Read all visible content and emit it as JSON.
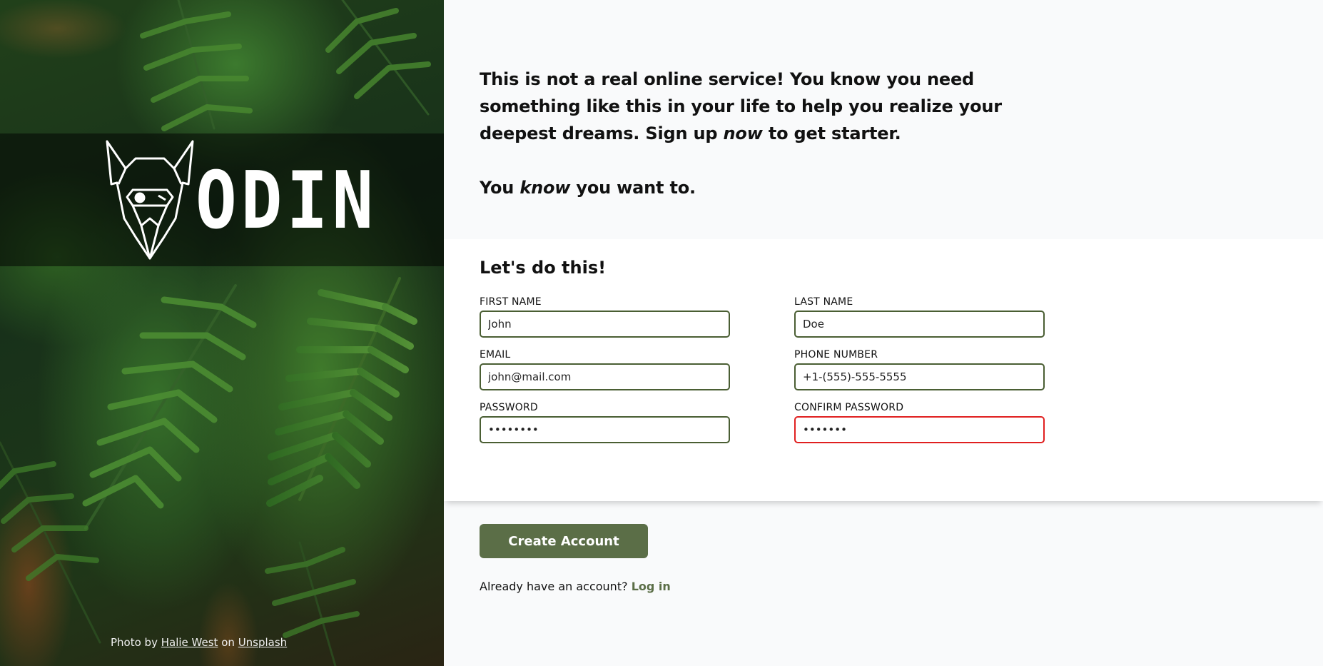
{
  "brand": {
    "wordmark": "ODIN",
    "colors": {
      "accent": "#5b6e47",
      "field_border": "#4a5e33",
      "error": "#e02020"
    }
  },
  "credit": {
    "prefix": "Photo by",
    "author": "Halie West",
    "middle": "on",
    "source": "Unsplash"
  },
  "intro": {
    "line1_a": "This is not a real online service! You know you need something like this in your life to help you realize your deepest dreams. Sign up ",
    "line1_em": "now",
    "line1_b": " to get starter.",
    "line2_a": "You ",
    "line2_em": "know",
    "line2_b": " you want to."
  },
  "form": {
    "heading": "Let's do this!",
    "fields": {
      "first_name": {
        "label": "First Name",
        "value": "John"
      },
      "last_name": {
        "label": "Last Name",
        "value": "Doe"
      },
      "email": {
        "label": "Email",
        "value": "john@mail.com"
      },
      "phone": {
        "label": "Phone Number",
        "value": "+1-(555)-555-5555"
      },
      "password": {
        "label": "Password",
        "value": "12345678"
      },
      "confirm_password": {
        "label": "Confirm Password",
        "value": "1234567",
        "invalid": true
      }
    }
  },
  "actions": {
    "create_label": "Create Account",
    "login_prompt": "Already have an account?",
    "login_link": "Log in"
  }
}
